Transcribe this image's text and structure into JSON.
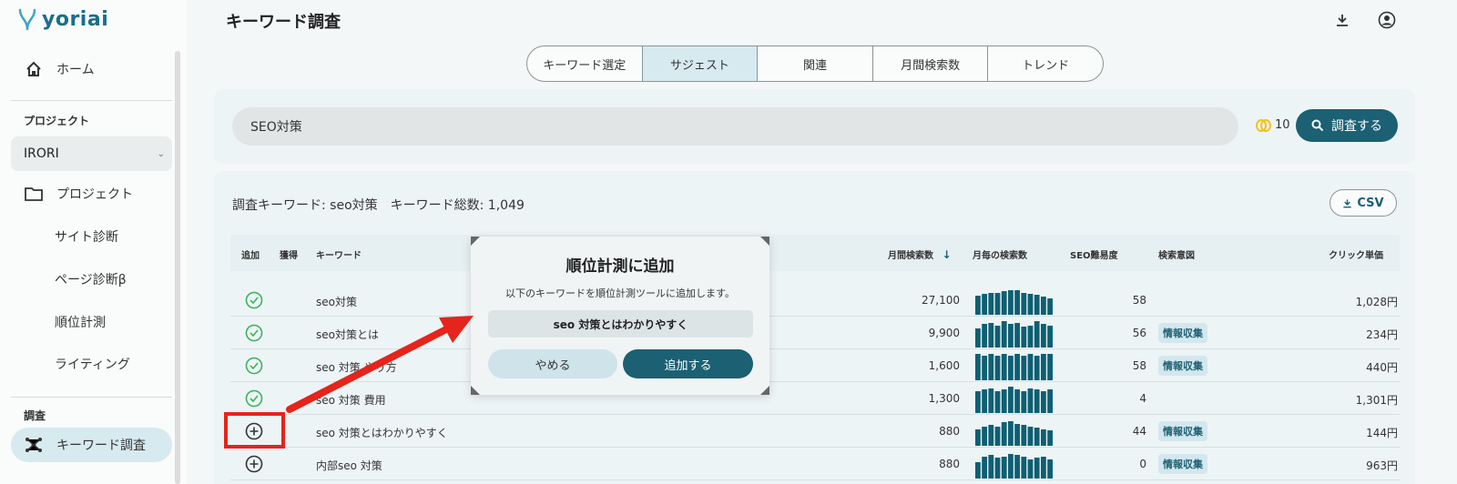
{
  "app": {
    "logo_text": "yoriai"
  },
  "sidebar": {
    "home": "ホーム",
    "project_section": "プロジェクト",
    "project_selected": "IRORI",
    "project_link": "プロジェクト",
    "items": [
      "サイト診断",
      "ページ診断β",
      "順位計測",
      "ライティング"
    ],
    "research_section": "調査",
    "active_item": "キーワード調査"
  },
  "header": {
    "title": "キーワード調査"
  },
  "tabs": [
    {
      "label": "キーワード選定",
      "active": false
    },
    {
      "label": "サジェスト",
      "active": true
    },
    {
      "label": "関連",
      "active": false
    },
    {
      "label": "月間検索数",
      "active": false
    },
    {
      "label": "トレンド",
      "active": false
    }
  ],
  "search": {
    "value": "SEO対策",
    "credits": "10",
    "button": "調査する"
  },
  "results": {
    "summary": "調査キーワード: seo対策　キーワード総数: 1,049",
    "csv": "CSV",
    "columns": {
      "add": "追加",
      "acquired": "獲得",
      "keyword": "キーワード",
      "monthly": "月間検索数",
      "trend": "月毎の検索数",
      "difficulty": "SEO難易度",
      "intent": "検索意図",
      "cpc": "クリック単価"
    },
    "rows": [
      {
        "added": true,
        "keyword": "seo対策",
        "volume": "27,100",
        "difficulty": "58",
        "intent": "",
        "cpc": "1,028円",
        "trend": [
          0.7,
          0.75,
          0.8,
          0.8,
          0.85,
          0.9,
          0.9,
          0.8,
          0.75,
          0.72,
          0.65,
          0.6
        ]
      },
      {
        "added": true,
        "keyword": "seo対策とは",
        "volume": "9,900",
        "difficulty": "56",
        "intent": "情報収集",
        "cpc": "234円",
        "trend": [
          0.7,
          0.85,
          0.9,
          0.8,
          0.95,
          0.85,
          0.9,
          0.75,
          0.8,
          0.95,
          0.85,
          0.8
        ]
      },
      {
        "added": true,
        "keyword": "seo 対策 やり方",
        "volume": "1,600",
        "difficulty": "58",
        "intent": "情報収集",
        "cpc": "440円",
        "trend": [
          0.95,
          0.9,
          0.95,
          0.9,
          0.95,
          0.9,
          0.95,
          0.9,
          0.95,
          0.9,
          0.95,
          0.95
        ]
      },
      {
        "added": true,
        "keyword": "seo 対策 費用",
        "volume": "1,300",
        "difficulty": "4",
        "intent": "",
        "cpc": "1,301円",
        "trend": [
          0.8,
          0.85,
          0.9,
          0.8,
          0.85,
          0.95,
          0.85,
          0.8,
          0.9,
          0.85,
          0.8,
          0.85
        ]
      },
      {
        "added": false,
        "keyword": "seo 対策とはわかりやすく",
        "volume": "880",
        "difficulty": "44",
        "intent": "情報収集",
        "cpc": "144円",
        "trend": [
          0.6,
          0.7,
          0.75,
          0.7,
          0.85,
          0.9,
          0.8,
          0.75,
          0.7,
          0.65,
          0.6,
          0.55
        ]
      },
      {
        "added": false,
        "keyword": "内部seo 対策",
        "volume": "880",
        "difficulty": "0",
        "intent": "情報収集",
        "cpc": "963円",
        "trend": [
          0.6,
          0.8,
          0.85,
          0.75,
          0.8,
          0.9,
          0.85,
          0.8,
          0.7,
          0.75,
          0.8,
          0.7
        ]
      }
    ]
  },
  "modal": {
    "title": "順位計測に追加",
    "description": "以下のキーワードを順位計測ツールに追加します。",
    "keyword": "seo 対策とはわかりやすく",
    "cancel": "やめる",
    "confirm": "追加する"
  },
  "colors": {
    "primary": "#1b6073",
    "accent_red": "#e5241b",
    "check_green": "#3bb35a",
    "bar": "#0f5f72"
  }
}
